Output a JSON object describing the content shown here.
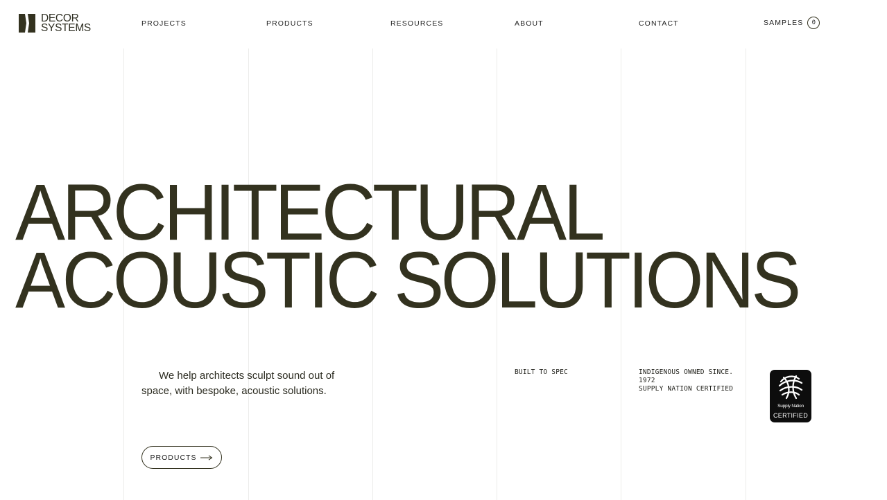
{
  "brand": {
    "line1": "DECOR",
    "line2": "SYSTEMS",
    "color": "#33321f"
  },
  "nav": {
    "items": [
      {
        "label": "PROJECTS"
      },
      {
        "label": "PRODUCTS"
      },
      {
        "label": "RESOURCES"
      },
      {
        "label": "ABOUT"
      },
      {
        "label": "CONTACT"
      }
    ],
    "samples_label": "SAMPLES",
    "samples_count": "0"
  },
  "hero": {
    "line1": "ARCHITECTURAL",
    "line2": "ACOUSTIC SOLUTIONS",
    "tagline": "We help architects sculpt sound out of space, with bespoke, acoustic solutions.",
    "cta_label": "PRODUCTS",
    "cta_icon": "arrow-right-icon"
  },
  "features": {
    "built_to_spec": "BUILT TO SPEC",
    "indigenous": "INDIGENOUS OWNED SINCE.\n1972\nSUPPLY NATION CERTIFIED"
  },
  "certification": {
    "line1": "Supply Nation",
    "line2": "CERTIFIED"
  }
}
